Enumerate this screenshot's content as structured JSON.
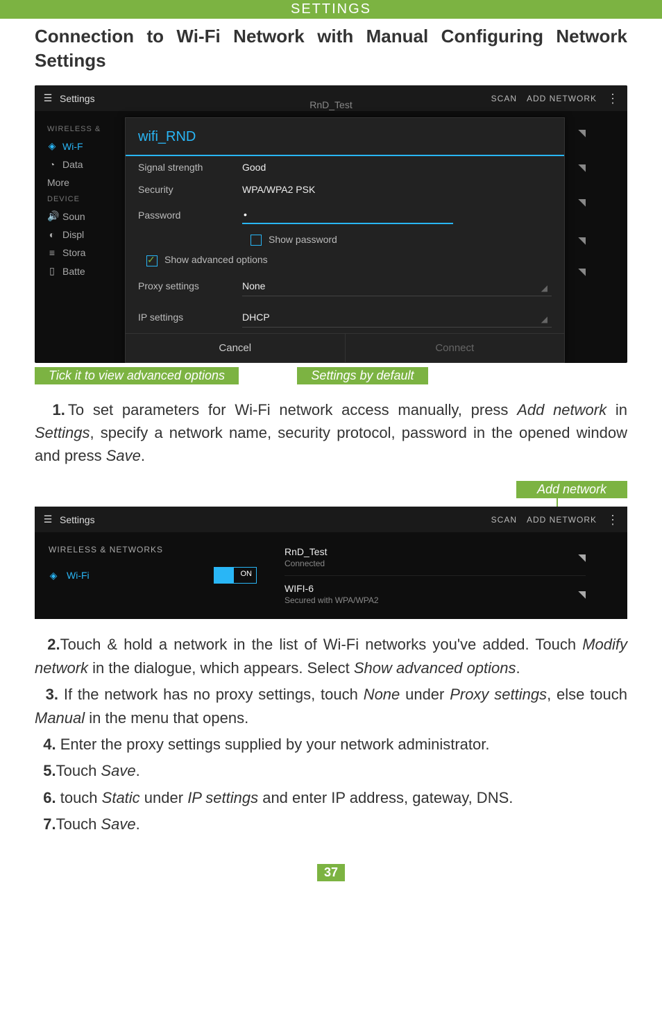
{
  "header": "SETTINGS",
  "heading_line1": "Connection to Wi-Fi Network with Manual Configuring Network",
  "heading_line2": "Settings",
  "shot1": {
    "topbar_title": "Settings",
    "scan": "SCAN",
    "add_network": "ADD NETWORK",
    "bg_network": "RnD_Test",
    "sidebar": {
      "section1": "WIRELESS &",
      "wifi": "Wi-F",
      "data": "Data",
      "more": "More",
      "section2": "DEVICE",
      "sound": "Soun",
      "display": "Displ",
      "storage": "Stora",
      "battery": "Batte"
    },
    "dialog": {
      "title": "wifi_RND",
      "signal_label": "Signal strength",
      "signal_value": "Good",
      "security_label": "Security",
      "security_value": "WPA/WPA2 PSK",
      "password_label": "Password",
      "password_value": "•",
      "show_password": "Show password",
      "show_advanced": "Show advanced options",
      "proxy_label": "Proxy settings",
      "proxy_value": "None",
      "ip_label": "IP settings",
      "ip_value": "DHCP",
      "cancel": "Cancel",
      "connect": "Connect"
    }
  },
  "callout_advanced": "Tick it to view advanced options",
  "callout_default": "Settings by default",
  "para1_a": "To set parameters for Wi-Fi network access manually, press ",
  "para1_b": "Add network",
  "para1_c": " in ",
  "para1_d": "Settings",
  "para1_e": ", specify a network name, security protocol, password in the opened window and press ",
  "para1_f": "Save",
  "para1_g": ".",
  "add_network_label": "Add network",
  "shot2": {
    "topbar_title": "Settings",
    "scan": "SCAN",
    "add_network": "ADD NETWORK",
    "section": "WIRELESS & NETWORKS",
    "wifi": "Wi-Fi",
    "toggle": "ON",
    "net1_name": "RnD_Test",
    "net1_sub": "Connected",
    "net2_name": "WIFI-6",
    "net2_sub": "Secured with WPA/WPA2"
  },
  "steps": {
    "s2a": "Touch & hold a network in the list of Wi-Fi networks you've added. Touch ",
    "s2b": "Modify network",
    "s2c": " in the dialogue, which appears. Select ",
    "s2d": "Show advanced options",
    "s2e": ".",
    "s3a": "If the network has no proxy settings, touch ",
    "s3b": "None",
    "s3c": " under ",
    "s3d": "Proxy settings",
    "s3e": ", else touch ",
    "s3f": "Manual",
    "s3g": " in the menu that opens.",
    "s4": "Enter the proxy settings supplied by your network administrator.",
    "s5a": "Touch ",
    "s5b": "Save",
    "s5c": ".",
    "s6a": "touch ",
    "s6b": "Static",
    "s6c": " under ",
    "s6d": "IP settings",
    "s6e": " and enter IP address, gateway, DNS.",
    "s7a": "Touch ",
    "s7b": "Save",
    "s7c": "."
  },
  "page_number": "37"
}
